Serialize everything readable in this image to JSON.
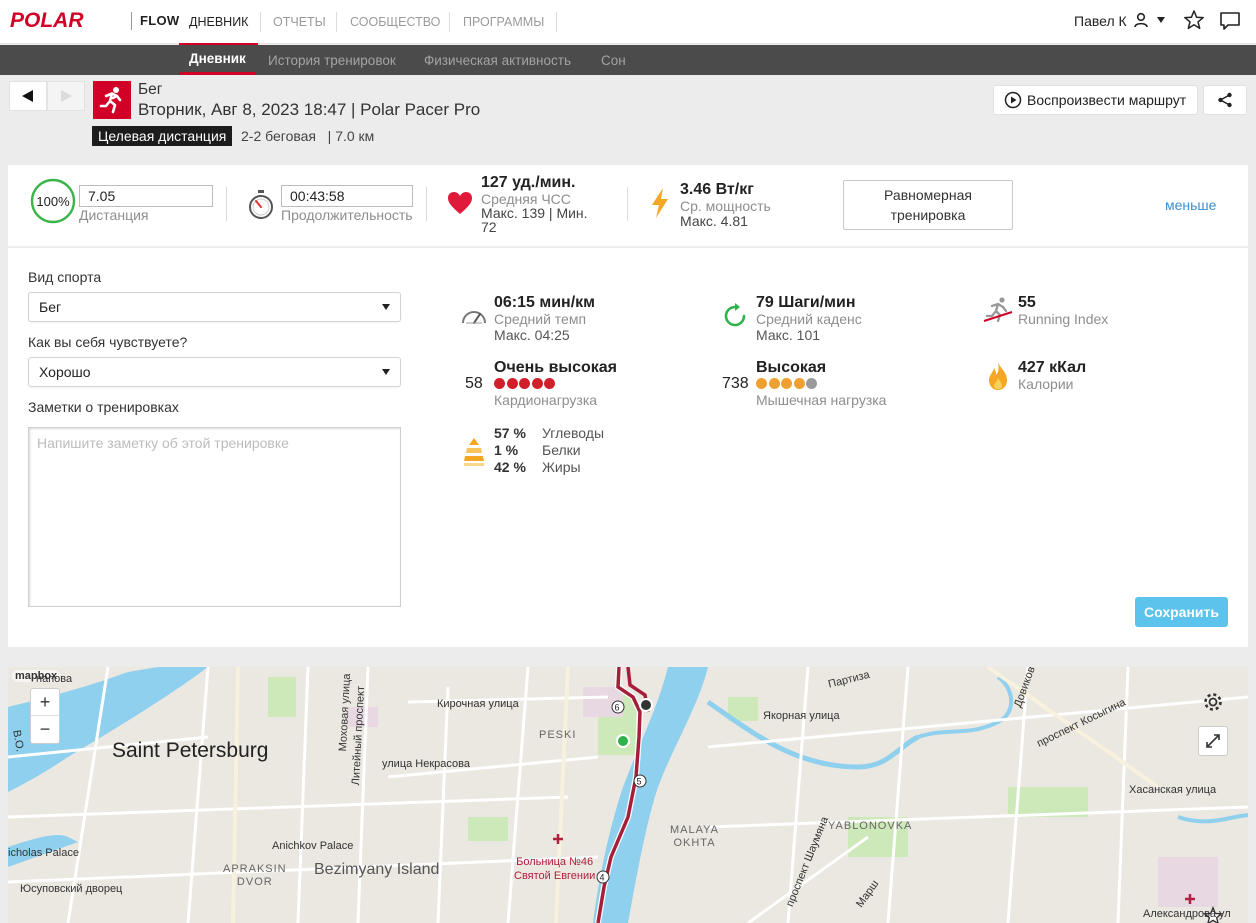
{
  "app": {
    "brand": "POLAR",
    "product": "FLOW"
  },
  "topnav": {
    "tabs": [
      {
        "label": "ДНЕВНИК",
        "active": true
      },
      {
        "label": "ОТЧЕТЫ",
        "active": false
      },
      {
        "label": "СООБЩЕСТВО",
        "active": false
      },
      {
        "label": "ПРОГРАММЫ",
        "active": false
      }
    ],
    "user": "Павел К",
    "icons": [
      "user-icon",
      "dropdown-caret-icon",
      "star-icon",
      "message-icon"
    ]
  },
  "subnav": {
    "tabs": [
      {
        "label": "Дневник",
        "active": true
      },
      {
        "label": "История тренировок",
        "active": false
      },
      {
        "label": "Физическая активность",
        "active": false
      },
      {
        "label": "Сон",
        "active": false
      }
    ]
  },
  "session": {
    "sport": "Бег",
    "date": "Вторник, Авг 8, 2023 18:47 | Polar Pacer Pro",
    "target_label": "Целевая дистанция",
    "target_info": "2-2 беговая   | 7.0 км",
    "replay_label": "Воспроизвести маршрут",
    "accent": "#d10027"
  },
  "summary": {
    "progress": "100%",
    "progress_fraction": 1.0,
    "distance_value": "7.05",
    "distance_label": "Дистанция",
    "duration_value": "00:43:58",
    "duration_label": "Продолжительность",
    "hr_value": "127 уд./мин.",
    "hr_label": "Средняя ЧСС",
    "hr_minmax": "Макс. 139  |  Мин. 72",
    "power_value": "3.46 Вт/кг",
    "power_label": "Ср. мощность",
    "power_max": "Макс. 4.81",
    "training_type": "Равномерная тренировка",
    "less_link": "меньше"
  },
  "form": {
    "sport_label": "Вид спорта",
    "sport_value": "Бег",
    "feeling_label": "Как вы себя чувствуете?",
    "feeling_value": "Хорошо",
    "notes_label": "Заметки о тренировках",
    "notes_placeholder": "Напишите заметку об этой тренировке",
    "save_label": "Сохранить"
  },
  "metrics": {
    "pace_value": "06:15 мин/км",
    "pace_label": "Средний темп",
    "pace_max": "Макс. 04:25",
    "cadence_value": "79 Шаги/мин",
    "cadence_label": "Средний каденс",
    "cadence_max": "Макс. 101",
    "running_index_value": "55",
    "running_index_label": "Running Index",
    "cardio_score": "58",
    "cardio_value": "Очень высокая",
    "cardio_label": "Кардионагрузка",
    "cardio_dots": 5,
    "cardio_dot_color": "#d0202c",
    "muscle_score": "738",
    "muscle_value": "Высокая",
    "muscle_label": "Мышечная нагрузка",
    "muscle_dots": 4,
    "muscle_dot_color": "#f0a030",
    "calories_value": "427 кКал",
    "calories_label": "Калории",
    "carbs_pct": "57 %",
    "carbs_label": "Углеводы",
    "protein_pct": "1 %",
    "protein_label": "Белки",
    "fat_pct": "42 %",
    "fat_label": "Жиры"
  },
  "map": {
    "attribution": "mapbox",
    "zoom_in": "+",
    "zoom_out": "−",
    "city": "Saint Petersburg",
    "labels": {
      "kirochnaya": "Кирочная улица",
      "nekrasova": "улица Некрасова",
      "peski": "PESKI",
      "liteyny": "Литейный проспект",
      "moskovsky": "Моховая улица",
      "yakornaya": "Якорная улица",
      "kosygina": "проспект Косыгина",
      "khasanskaya": "Хасанская улица",
      "malaya_okhta": "MALAYA\nOKHTA",
      "yablonovka": "YABLONOVKA",
      "anichkov": "Anichkov Palace",
      "nicholas": "icholas Palace",
      "yusupov": "Юсуповский дворец",
      "apraksin": "APRAKSIN\nDVOR",
      "bezimyany": "Bezimyany Island",
      "hospital": "Больница №46\nСвятой Евгении",
      "shaumyana": "проспект Шаумяна",
      "partizana": "Партиза",
      "dovikov": "Довиков",
      "aleksandrov": "Александрова ул",
      "napova": "напова",
      "bo": "В.О.",
      "partizanskaya": "Марш"
    },
    "route_color": "#a31f3a"
  }
}
